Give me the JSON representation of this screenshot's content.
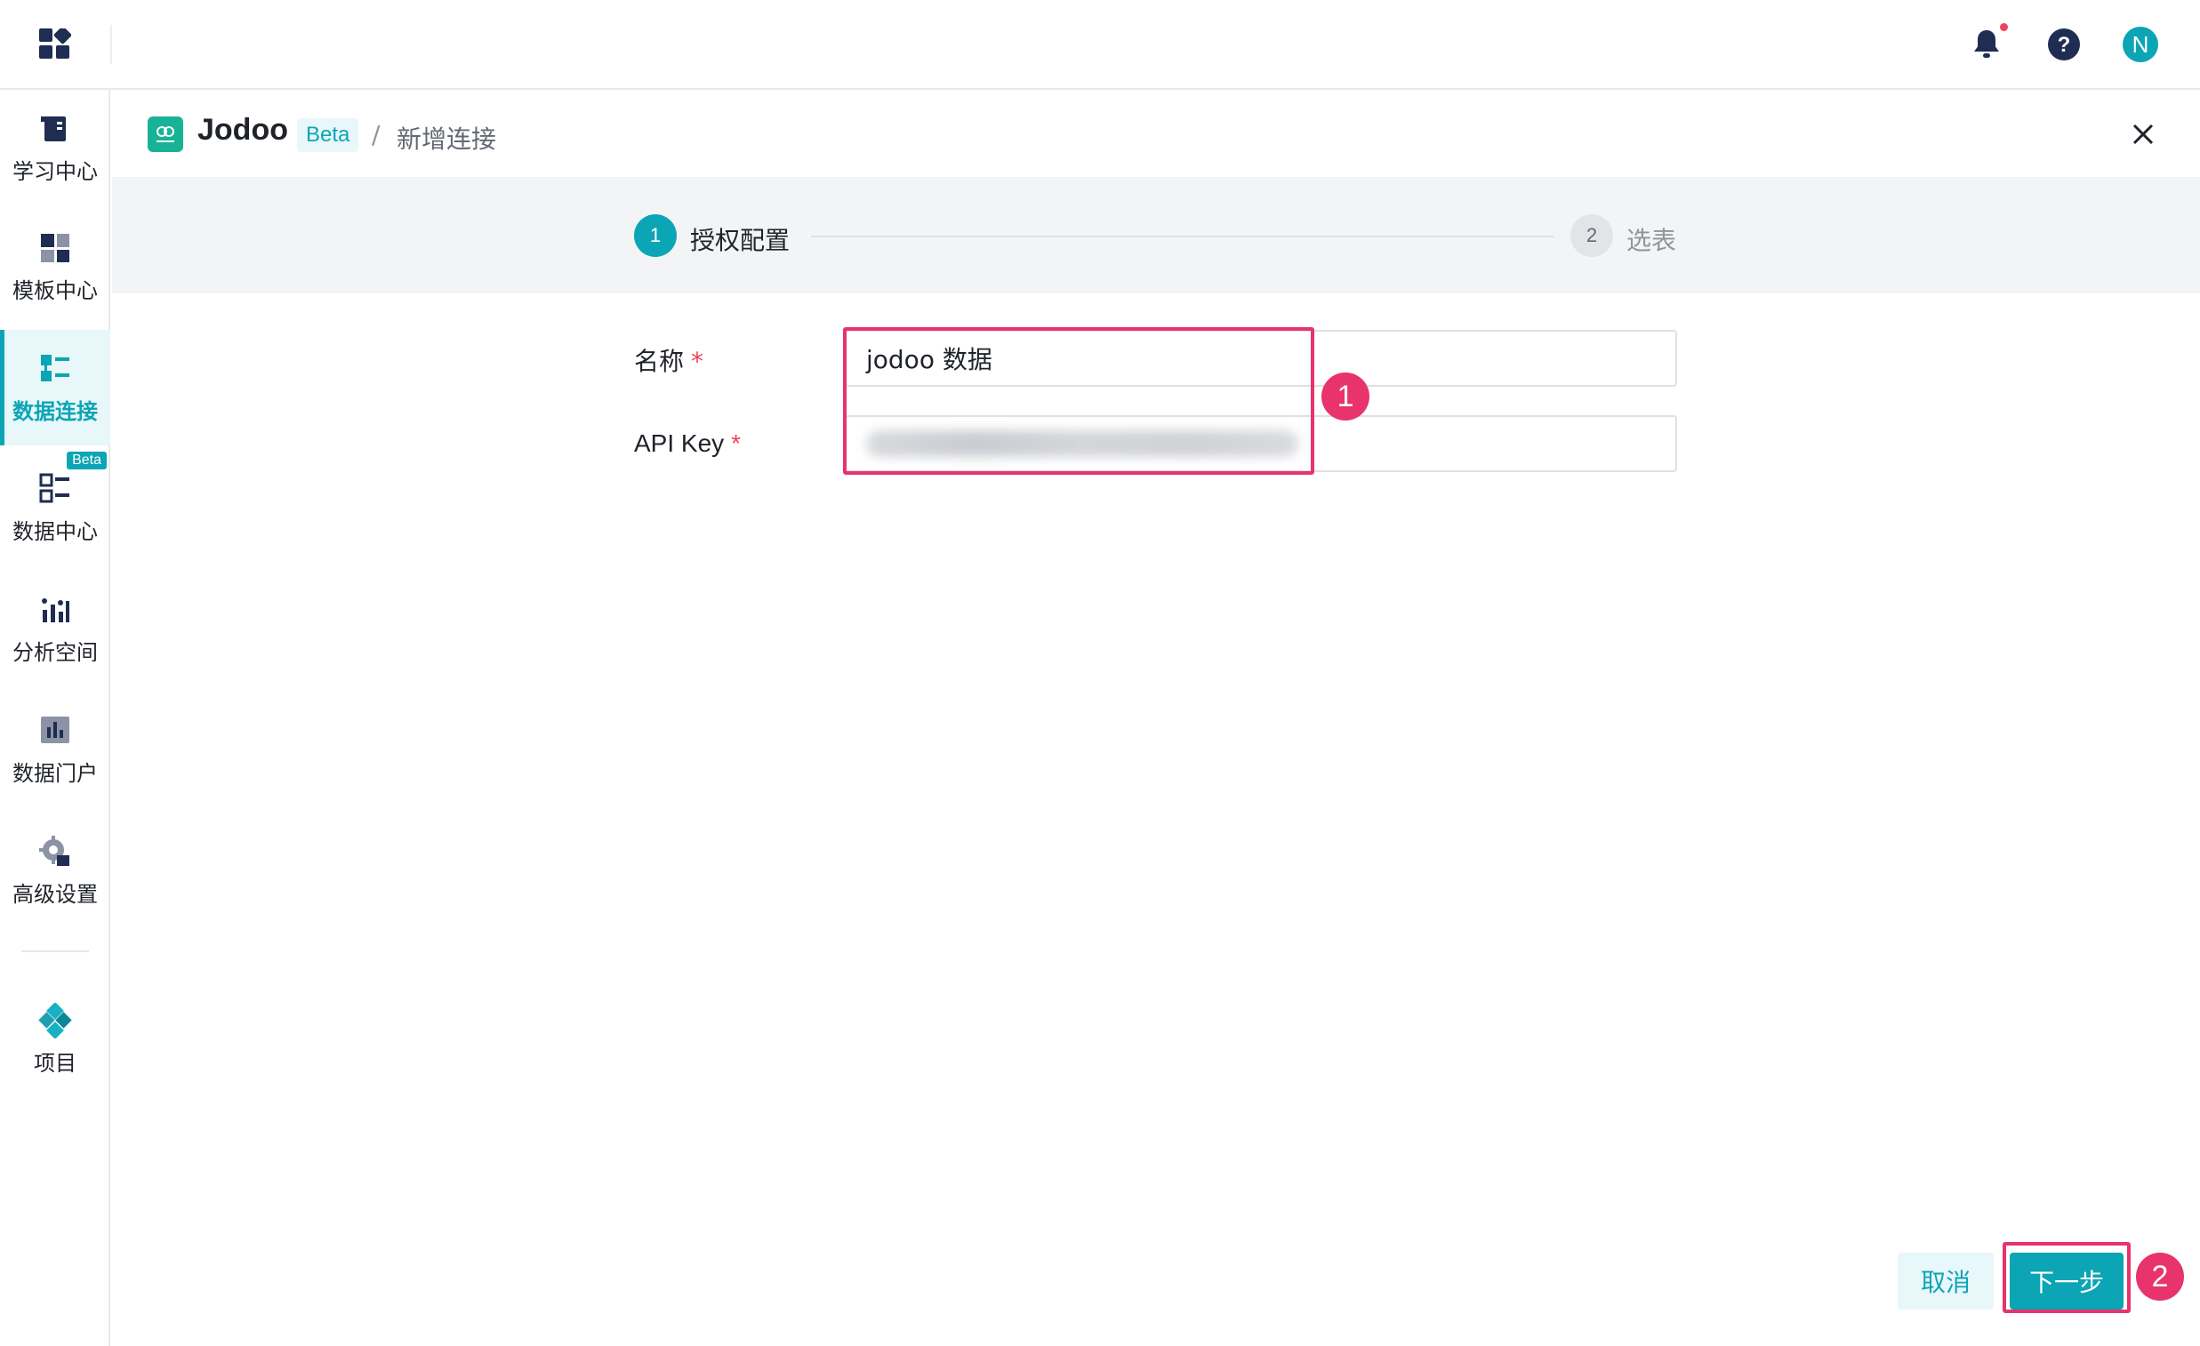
{
  "topbar": {
    "apps_icon": "grid-apps-icon",
    "icons": [
      "bell-icon",
      "help-icon"
    ],
    "avatar_initial": "N"
  },
  "sidebar": {
    "items": [
      {
        "label": "学习中心",
        "icon": "book-icon"
      },
      {
        "label": "模板中心",
        "icon": "template-icon"
      },
      {
        "label": "数据连接",
        "icon": "data-connect-icon",
        "active": true
      },
      {
        "label": "数据中心",
        "icon": "data-center-icon",
        "badge": "Beta"
      },
      {
        "label": "分析空间",
        "icon": "analysis-icon"
      },
      {
        "label": "数据门户",
        "icon": "portal-icon"
      },
      {
        "label": "高级设置",
        "icon": "gear-icon"
      },
      {
        "label": "项目",
        "icon": "project-icon"
      }
    ]
  },
  "header": {
    "brand": "Jodoo",
    "beta_tag": "Beta",
    "separator": "/",
    "page": "新增连接"
  },
  "steps": [
    {
      "number": "1",
      "label": "授权配置",
      "state": "active"
    },
    {
      "number": "2",
      "label": "选表",
      "state": "inactive"
    }
  ],
  "form": {
    "name_label": "名称",
    "name_value": "jodoo 数据",
    "key_label": "API Key",
    "required_mark": "*"
  },
  "annotations": [
    "1",
    "2"
  ],
  "buttons": {
    "cancel": "取消",
    "next": "下一步"
  },
  "colors": {
    "accent": "#0ba5b6",
    "highlight": "#e8336d",
    "required": "#f0425a"
  }
}
